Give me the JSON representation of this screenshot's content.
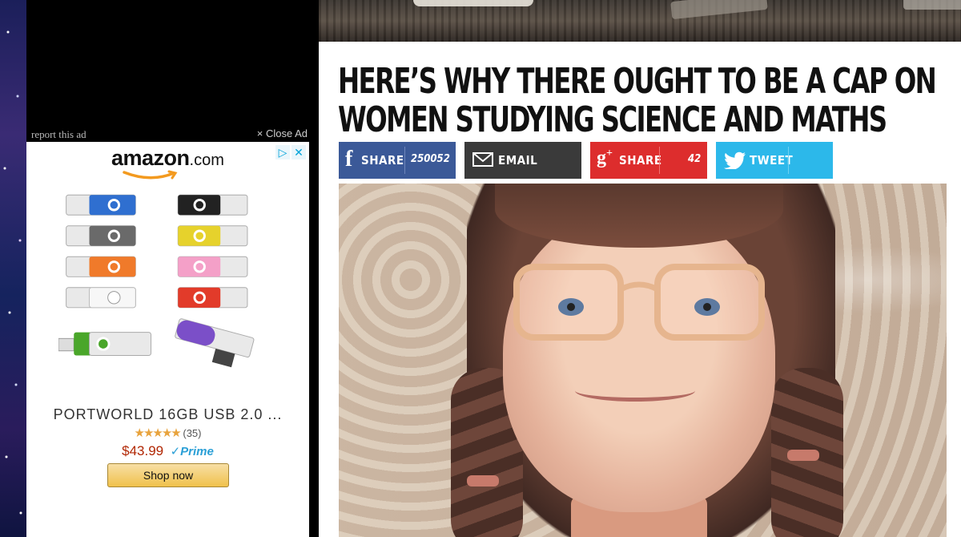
{
  "ad": {
    "report_label": "report this ad",
    "close_label": "× Close Ad",
    "brand_word": "amazon",
    "brand_suffix": ".com",
    "adchoices_icons": [
      "adchoices-triangle-icon",
      "close-x-icon"
    ],
    "product_title": "PORTWORLD 16GB USB 2.0 ...",
    "stars": "★★★★★",
    "rating_count": "(35)",
    "price": "$43.99",
    "prime_label": "✓Prime",
    "shop_button": "Shop now",
    "rating_value": 4.5,
    "usb_colors": [
      "#2f6fd0",
      "#222222",
      "#6a6a6a",
      "#e6d22c",
      "#f07a2a",
      "#f4a0c8",
      "#ffffff",
      "#e23b2a",
      "#4aa62a",
      "#7b4fc8"
    ]
  },
  "article": {
    "headline_line1": "HERE’S WHY THERE OUGHT TO BE A CAP ON",
    "headline_line2": "WOMEN STUDYING SCIENCE AND MATHS",
    "share": {
      "facebook_label": "SHARE",
      "facebook_count": "250052",
      "email_label": "EMAIL",
      "gplus_label": "SHARE",
      "gplus_count": "42",
      "twitter_label": "TWEET"
    }
  },
  "colors": {
    "facebook": "#3b5998",
    "email": "#3a3a3a",
    "gplus": "#dd2d2d",
    "twitter": "#2cb8ea",
    "price": "#b12704",
    "prime": "#2a9fd6"
  }
}
